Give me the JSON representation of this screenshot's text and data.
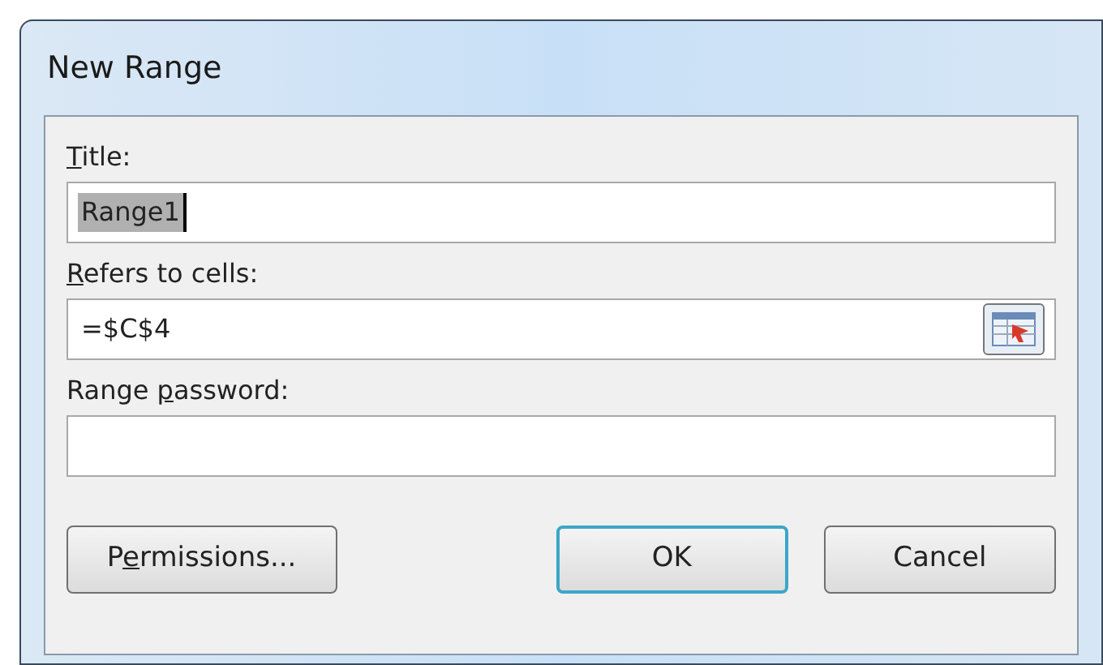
{
  "window": {
    "title": "New Range"
  },
  "fields": [
    {
      "label": {
        "key": "T",
        "rest": "itle:"
      },
      "value": "Range1",
      "text_selected": true
    },
    {
      "label": {
        "key": "R",
        "rest": "efers to cells:"
      },
      "value": "=$C$4",
      "picker": true
    },
    {
      "label": {
        "lead": "Range ",
        "key": "p",
        "rest": "assword:"
      }
    }
  ],
  "buttons": [
    {
      "label": {
        "lead": "P",
        "key": "e",
        "rest": "rmissions..."
      },
      "default": false
    },
    {
      "label": {
        "rest": "OK"
      },
      "default": true
    },
    {
      "label": {
        "rest": "Cancel"
      },
      "default": false
    }
  ]
}
